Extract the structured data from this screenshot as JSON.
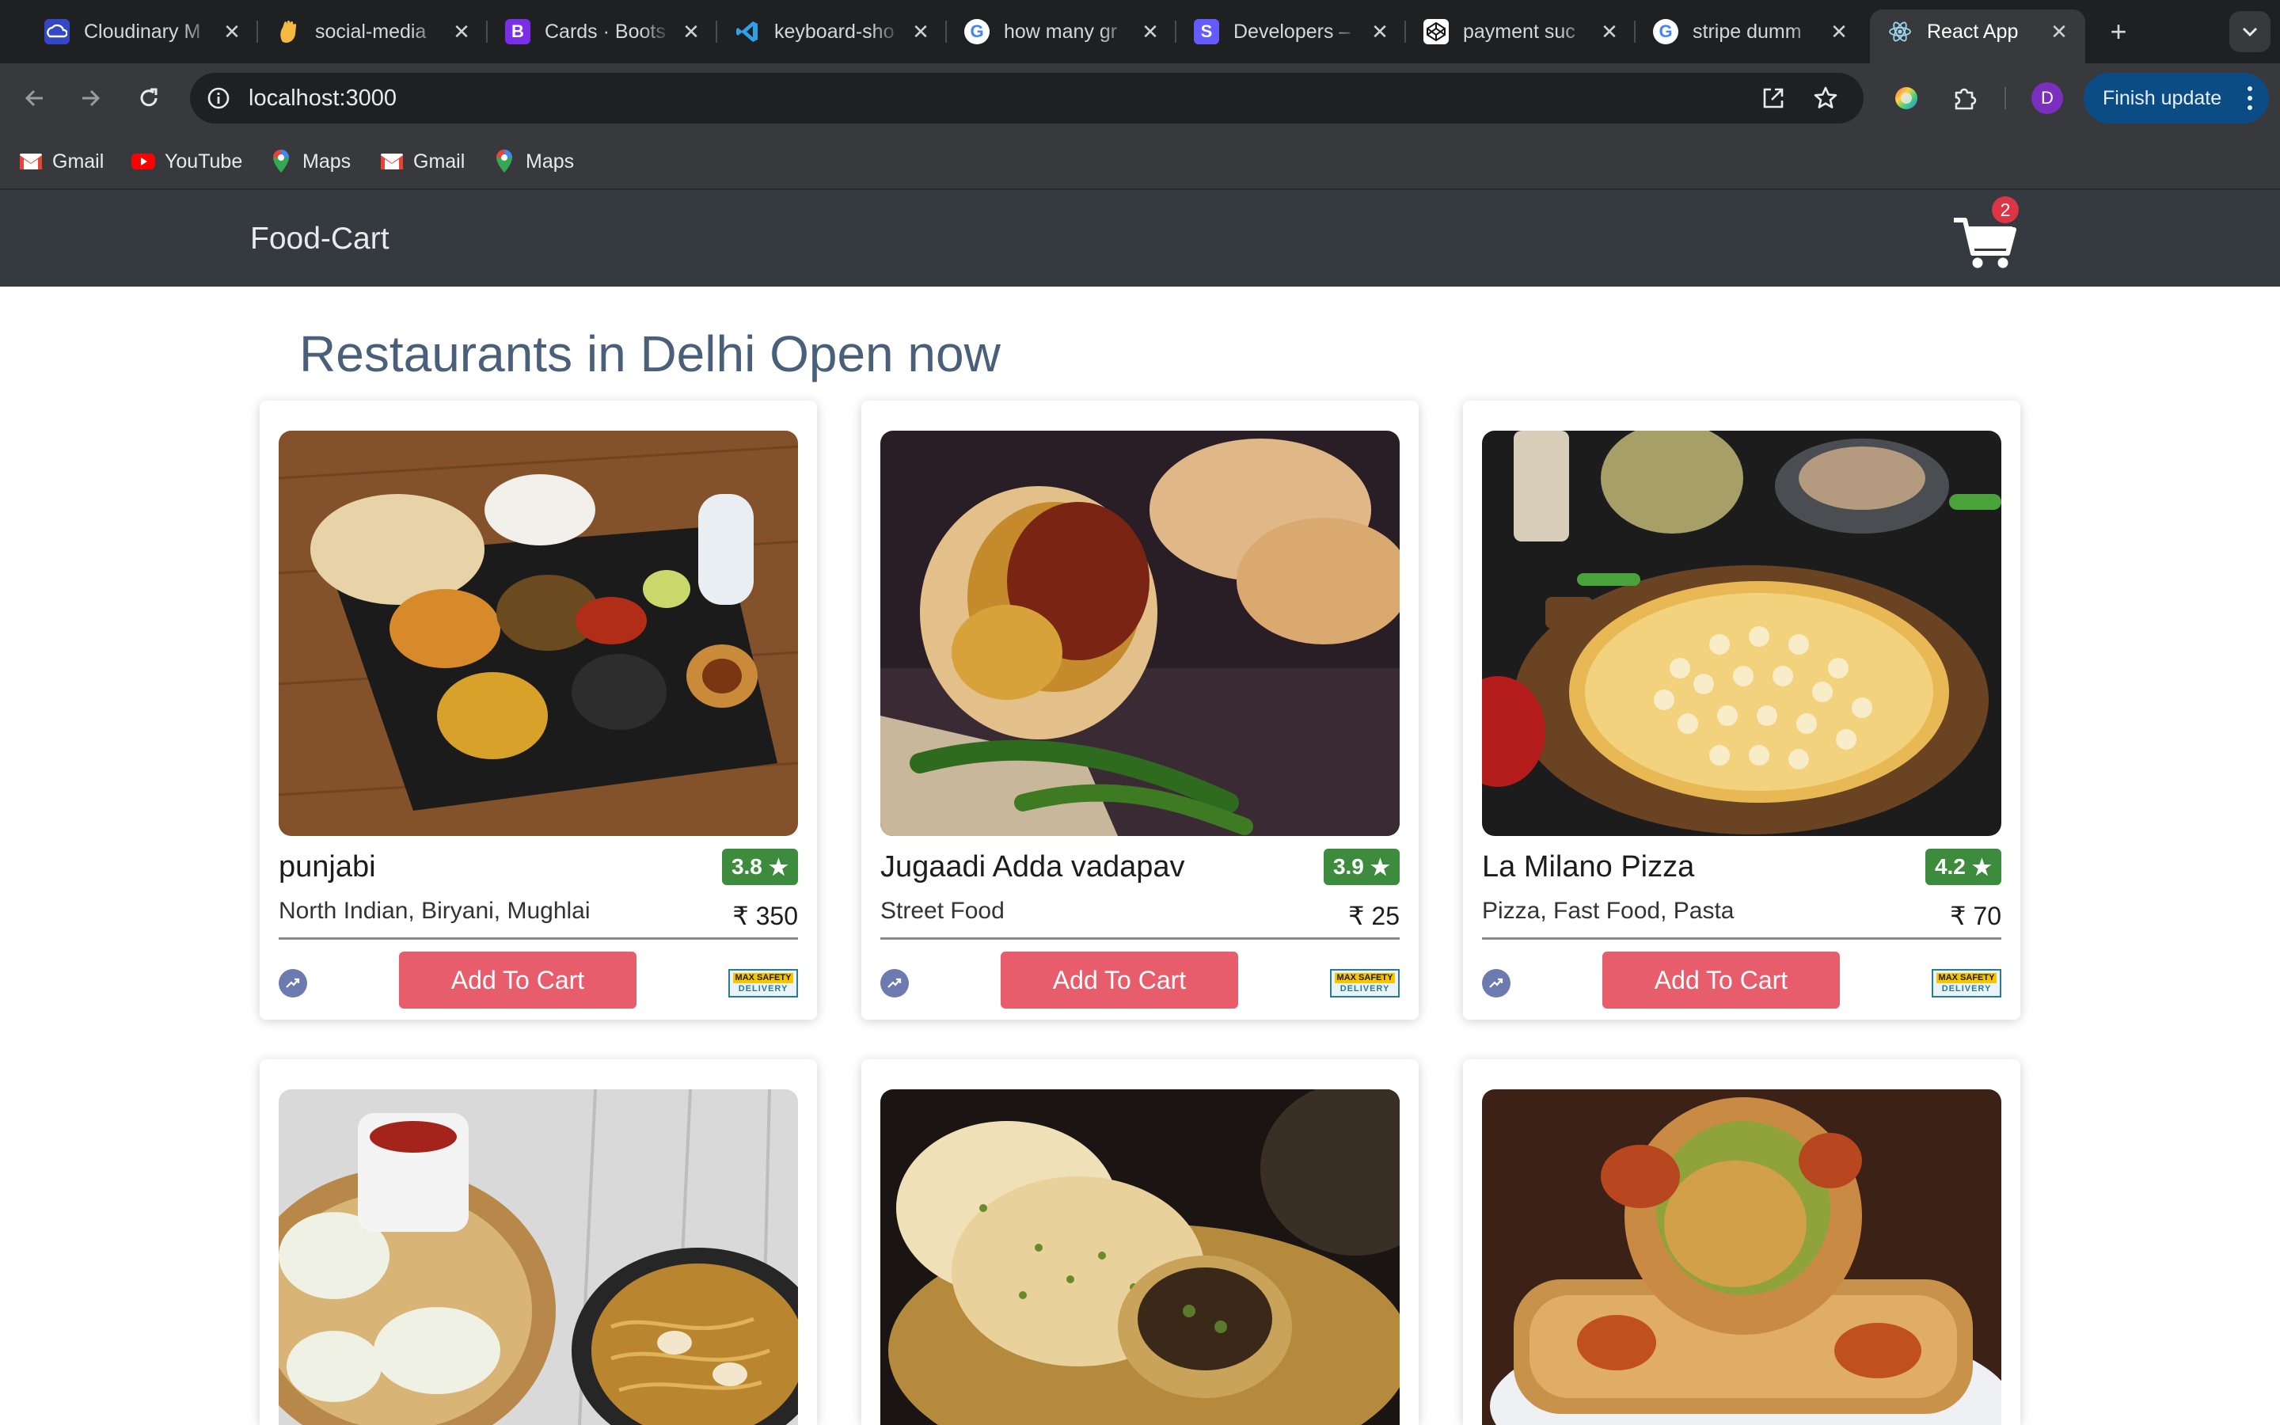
{
  "browser": {
    "tabs": [
      {
        "title": "Cloudinary M",
        "icon": "cloudinary-icon"
      },
      {
        "title": "social-media",
        "icon": "hand-icon"
      },
      {
        "title": "Cards · Boots",
        "icon": "bootstrap-icon"
      },
      {
        "title": "keyboard-sho",
        "icon": "vscode-icon"
      },
      {
        "title": "how many gr",
        "icon": "google-icon"
      },
      {
        "title": "Developers –",
        "icon": "stripe-icon"
      },
      {
        "title": "payment suc",
        "icon": "codepen-icon"
      },
      {
        "title": "stripe dumm",
        "icon": "google-icon"
      },
      {
        "title": "React App",
        "icon": "react-icon"
      }
    ],
    "url": "localhost:3000",
    "profile_initial": "D",
    "update_label": "Finish update",
    "bookmarks": [
      {
        "label": "Gmail",
        "icon": "gmail-icon"
      },
      {
        "label": "YouTube",
        "icon": "youtube-icon"
      },
      {
        "label": "Maps",
        "icon": "maps-icon"
      },
      {
        "label": "Gmail",
        "icon": "gmail-icon"
      },
      {
        "label": "Maps",
        "icon": "maps-icon"
      }
    ]
  },
  "app": {
    "brand": "Food-Cart",
    "cart_count": "2",
    "heading": "Restaurants in Delhi Open now",
    "add_to_cart_label": "Add To Cart",
    "safety_badge": {
      "line1": "MAX SAFETY",
      "line2": "DELIVERY"
    },
    "restaurants": [
      {
        "name": "punjabi",
        "rating": "3.8",
        "cuisine": "North Indian, Biryani, Mughlai",
        "price": "₹ 350"
      },
      {
        "name": "Jugaadi Adda vadapav",
        "rating": "3.9",
        "cuisine": "Street Food",
        "price": "₹ 25"
      },
      {
        "name": "La Milano Pizza",
        "rating": "4.2",
        "cuisine": "Pizza, Fast Food, Pasta",
        "price": "₹ 70"
      },
      {
        "name": "",
        "rating": "",
        "cuisine": "",
        "price": ""
      },
      {
        "name": "",
        "rating": "",
        "cuisine": "",
        "price": ""
      },
      {
        "name": "",
        "rating": "",
        "cuisine": "",
        "price": ""
      }
    ],
    "colors": {
      "navbar": "#343a40",
      "rating_bg": "#3d8b3d",
      "button": "#e85d6c",
      "heading": "#4a5f7a"
    }
  }
}
